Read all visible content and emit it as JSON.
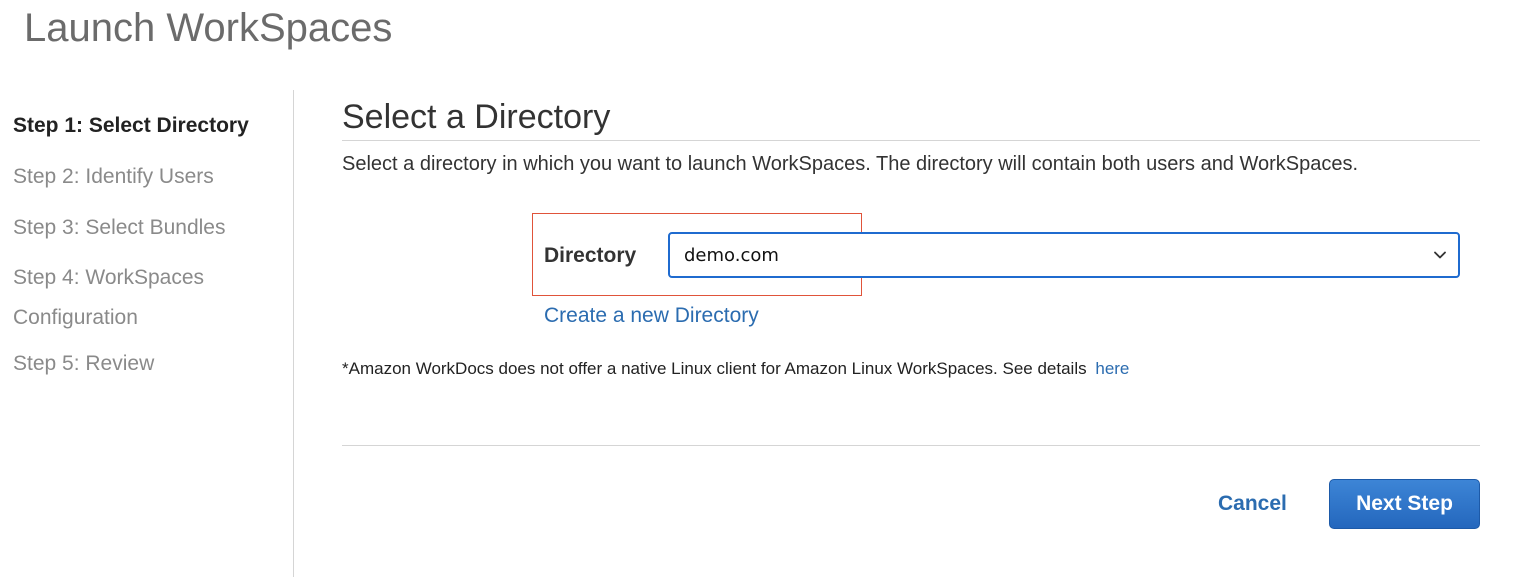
{
  "page": {
    "title": "Launch WorkSpaces"
  },
  "steps": [
    {
      "label": "Step 1: Select Directory",
      "active": true
    },
    {
      "label": "Step 2: Identify Users",
      "active": false
    },
    {
      "label": "Step 3: Select Bundles",
      "active": false
    },
    {
      "label_line1": "Step 4: WorkSpaces",
      "label_line2": "Configuration",
      "active": false
    },
    {
      "label": "Step 5: Review",
      "active": false
    }
  ],
  "main": {
    "section_title": "Select a Directory",
    "description": "Select a directory in which you want to launch WorkSpaces. The directory will contain both users and WorkSpaces.",
    "directory_label": "Directory",
    "directory_value": "demo.com",
    "create_link": "Create a new Directory",
    "note_text": "*Amazon WorkDocs does not offer a native Linux client for Amazon Linux WorkSpaces. See details",
    "note_link": "here"
  },
  "footer": {
    "cancel_label": "Cancel",
    "next_label": "Next Step"
  },
  "icons": {
    "dropdown": "chevron-down-icon"
  },
  "colors": {
    "link": "#2b6cb0",
    "primary_button": "#2467bd",
    "focus_border": "#1f6bcf",
    "highlight": "#e0533a"
  }
}
